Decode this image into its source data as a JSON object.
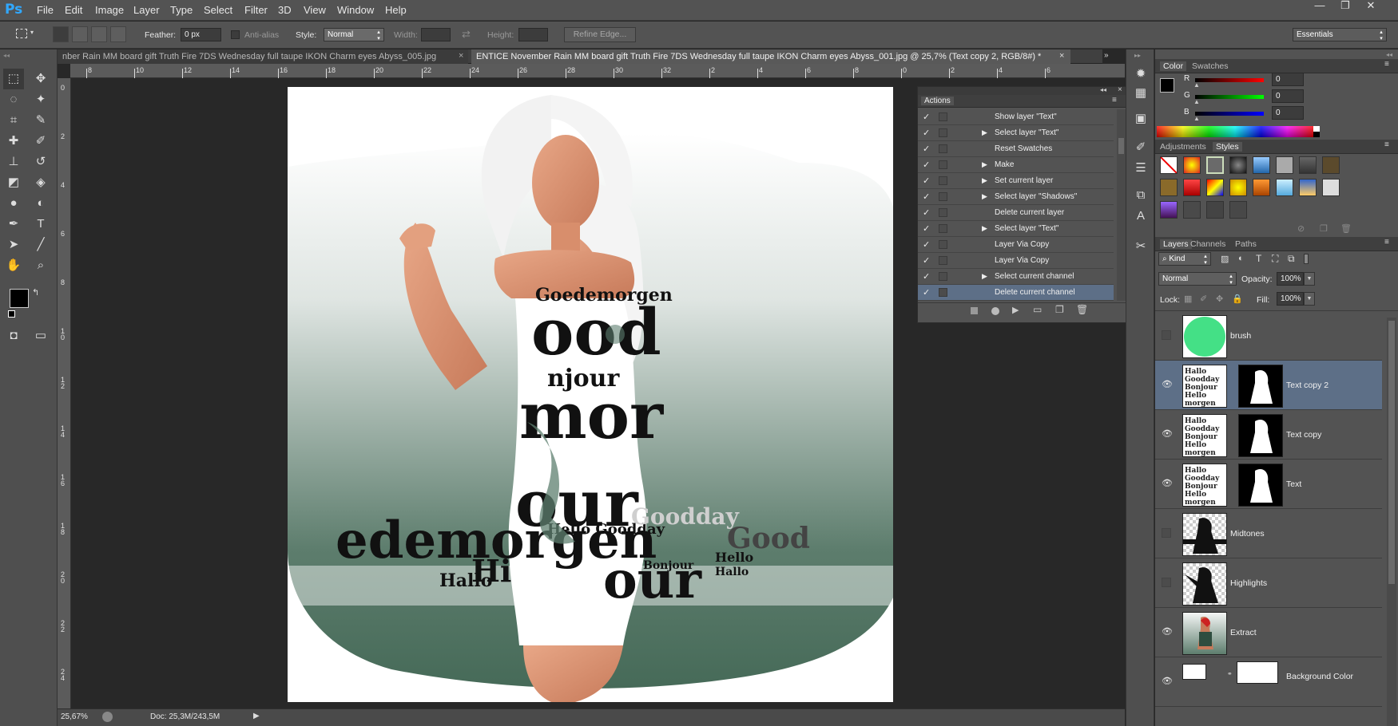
{
  "app": {
    "logo": "Ps"
  },
  "menu": [
    "File",
    "Edit",
    "Image",
    "Layer",
    "Type",
    "Select",
    "Filter",
    "3D",
    "View",
    "Window",
    "Help"
  ],
  "options": {
    "feather_label": "Feather:",
    "feather_value": "0 px",
    "antialias_label": "Anti-alias",
    "style_label": "Style:",
    "style_value": "Normal",
    "width_label": "Width:",
    "height_label": "Height:",
    "refine_edge": "Refine Edge...",
    "workspace": "Essentials"
  },
  "tabs": [
    {
      "label": "nber Rain MM board gift Truth Fire 7DS Wednesday full taupe IKON Charm eyes Abyss_005.jpg",
      "close": "×"
    },
    {
      "label": "ENTICE November Rain MM board gift Truth Fire 7DS Wednesday full taupe IKON Charm eyes Abyss_001.jpg @ 25,7% (Text copy 2, RGB/8#) *",
      "close": "×"
    }
  ],
  "ruler": {
    "h_labels": [
      "8",
      "10",
      "12",
      "14",
      "16",
      "18",
      "20",
      "22",
      "24",
      "26",
      "28",
      "30",
      "32",
      "2",
      "4",
      "6",
      "8",
      "0",
      "2",
      "4",
      "6"
    ],
    "v_labels": [
      "0",
      "2",
      "4",
      "6",
      "8",
      "1\n0",
      "1\n2",
      "1\n4",
      "1\n6",
      "1\n8",
      "2\n0",
      "2\n2",
      "2\n4"
    ]
  },
  "canvas_words": [
    "ood",
    "mor",
    "our",
    "Goedemorgen",
    "Hello Goodday",
    "edemorgen",
    "Good",
    "Hello",
    "Hallo",
    "Hi",
    "Bonjour",
    "njour",
    "Hallo",
    "Goodday",
    "our"
  ],
  "status": {
    "zoom": "25,67%",
    "doc": "Doc: 25,3M/243,5M"
  },
  "actions": {
    "title": "Actions",
    "items": [
      {
        "name": "Show layer \"Text\"",
        "expand": false
      },
      {
        "name": "Select layer \"Text\"",
        "expand": true
      },
      {
        "name": "Reset Swatches",
        "expand": false
      },
      {
        "name": "Make",
        "expand": true
      },
      {
        "name": "Set current layer",
        "expand": true
      },
      {
        "name": "Select layer \"Shadows\"",
        "expand": true
      },
      {
        "name": "Delete current layer",
        "expand": false
      },
      {
        "name": "Select layer \"Text\"",
        "expand": true
      },
      {
        "name": "Layer Via Copy",
        "expand": false
      },
      {
        "name": "Layer Via Copy",
        "expand": false
      },
      {
        "name": "Select current channel",
        "expand": true
      },
      {
        "name": "Delete current channel",
        "expand": false
      }
    ]
  },
  "color_panel": {
    "tabs": [
      "Color",
      "Swatches"
    ],
    "channels": [
      {
        "label": "R",
        "value": "0"
      },
      {
        "label": "G",
        "value": "0"
      },
      {
        "label": "B",
        "value": "0"
      }
    ]
  },
  "adjustments_panel": {
    "tabs": [
      "Adjustments",
      "Styles"
    ]
  },
  "layers_panel": {
    "tabs": [
      "Layers",
      "Channels",
      "Paths"
    ],
    "filter_kind": "Kind",
    "blend_mode": "Normal",
    "opacity_label": "Opacity:",
    "opacity_value": "100%",
    "lock_label": "Lock:",
    "fill_label": "Fill:",
    "fill_value": "100%",
    "layers": [
      {
        "name": "brush",
        "visible": false,
        "selected": false
      },
      {
        "name": "Text copy 2",
        "visible": true,
        "selected": true
      },
      {
        "name": "Text copy",
        "visible": true,
        "selected": false
      },
      {
        "name": "Text",
        "visible": true,
        "selected": false
      },
      {
        "name": "Midtones",
        "visible": false,
        "selected": false
      },
      {
        "name": "Highlights",
        "visible": false,
        "selected": false
      },
      {
        "name": "Extract",
        "visible": true,
        "selected": false
      },
      {
        "name": "Background Color",
        "visible": true,
        "selected": false
      }
    ]
  },
  "colors": {
    "accent": "#31a8ff",
    "selected_layer": "#5d6f87",
    "brush_green": "#44e086"
  }
}
